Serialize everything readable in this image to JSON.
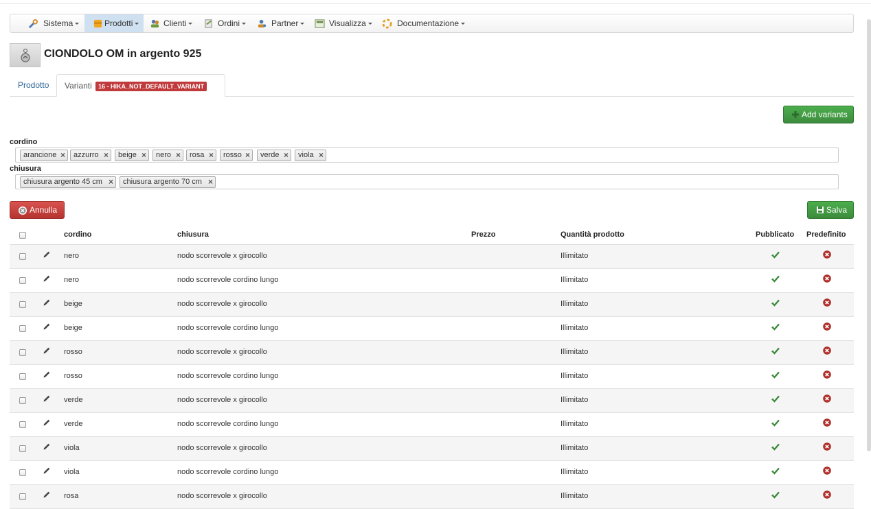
{
  "menu": [
    {
      "label": "Sistema",
      "icon": "wrench-icon"
    },
    {
      "label": "Prodotti",
      "icon": "box-icon",
      "active": true
    },
    {
      "label": "Clienti",
      "icon": "users-icon"
    },
    {
      "label": "Ordini",
      "icon": "orders-icon"
    },
    {
      "label": "Partner",
      "icon": "partner-icon"
    },
    {
      "label": "Visualizza",
      "icon": "display-icon"
    },
    {
      "label": "Documentazione",
      "icon": "help-icon"
    }
  ],
  "product": {
    "title": "CIONDOLO OM in argento 925",
    "thumb_icon": "pendant-icon"
  },
  "tabs": {
    "prodotto": "Prodotto",
    "varianti": "Varianti",
    "varianti_badge": "16 - HIKA_NOT_DEFAULT_VARIANT"
  },
  "buttons": {
    "add_variants": "Add variants",
    "annulla": "Annulla",
    "salva": "Salva"
  },
  "characteristics": [
    {
      "label": "cordino",
      "values": [
        "arancione",
        "azzurro",
        "beige",
        "nero",
        "rosa",
        "rosso",
        "verde",
        "viola"
      ]
    },
    {
      "label": "chiusura",
      "values": [
        "chiusura argento 45 cm",
        "chiusura argento 70 cm"
      ]
    }
  ],
  "table": {
    "headers": {
      "cordino": "cordino",
      "chiusura": "chiusura",
      "prezzo": "Prezzo",
      "quantita": "Quantità prodotto",
      "pubblicato": "Pubblicato",
      "predefinito": "Predefinito"
    },
    "rows": [
      {
        "cordino": "nero",
        "chiusura": "nodo scorrevole x girocollo",
        "prezzo": "",
        "quantita": "Illimitato",
        "pubblicato": true,
        "predefinito": false
      },
      {
        "cordino": "nero",
        "chiusura": "nodo scorrevole cordino lungo",
        "prezzo": "",
        "quantita": "Illimitato",
        "pubblicato": true,
        "predefinito": false
      },
      {
        "cordino": "beige",
        "chiusura": "nodo scorrevole x girocollo",
        "prezzo": "",
        "quantita": "Illimitato",
        "pubblicato": true,
        "predefinito": false
      },
      {
        "cordino": "beige",
        "chiusura": "nodo scorrevole cordino lungo",
        "prezzo": "",
        "quantita": "Illimitato",
        "pubblicato": true,
        "predefinito": false
      },
      {
        "cordino": "rosso",
        "chiusura": "nodo scorrevole x girocollo",
        "prezzo": "",
        "quantita": "Illimitato",
        "pubblicato": true,
        "predefinito": false
      },
      {
        "cordino": "rosso",
        "chiusura": "nodo scorrevole cordino lungo",
        "prezzo": "",
        "quantita": "Illimitato",
        "pubblicato": true,
        "predefinito": false
      },
      {
        "cordino": "verde",
        "chiusura": "nodo scorrevole x girocollo",
        "prezzo": "",
        "quantita": "Illimitato",
        "pubblicato": true,
        "predefinito": false
      },
      {
        "cordino": "verde",
        "chiusura": "nodo scorrevole cordino lungo",
        "prezzo": "",
        "quantita": "Illimitato",
        "pubblicato": true,
        "predefinito": false
      },
      {
        "cordino": "viola",
        "chiusura": "nodo scorrevole x girocollo",
        "prezzo": "",
        "quantita": "Illimitato",
        "pubblicato": true,
        "predefinito": false
      },
      {
        "cordino": "viola",
        "chiusura": "nodo scorrevole cordino lungo",
        "prezzo": "",
        "quantita": "Illimitato",
        "pubblicato": true,
        "predefinito": false
      },
      {
        "cordino": "rosa",
        "chiusura": "nodo scorrevole x girocollo",
        "prezzo": "",
        "quantita": "Illimitato",
        "pubblicato": true,
        "predefinito": false
      }
    ]
  },
  "colors": {
    "accent_blue": "#2a6496",
    "green": "#449d44",
    "red": "#c0393b",
    "menu_active": "#cfe0f1"
  }
}
